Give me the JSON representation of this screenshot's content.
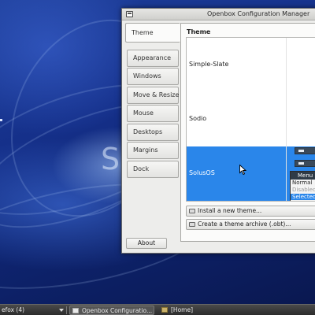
{
  "wallpaper": {
    "logo_text": "S"
  },
  "window": {
    "title": "Openbox Configuration Manager",
    "tabs": [
      {
        "label": "Theme",
        "active": true
      },
      {
        "label": "Appearance"
      },
      {
        "label": "Windows"
      },
      {
        "label": "Move & Resize"
      },
      {
        "label": "Mouse"
      },
      {
        "label": "Desktops"
      },
      {
        "label": "Margins"
      },
      {
        "label": "Dock"
      }
    ],
    "section_heading": "Theme",
    "themes": [
      {
        "name": "Simple-Slate"
      },
      {
        "name": "Sodio"
      },
      {
        "name": "SolusOS",
        "selected": true
      }
    ],
    "preview": {
      "menu_title": "Menu",
      "items": [
        "Normal",
        "Disabled",
        "Selected"
      ]
    },
    "install_button": "Install a new theme...",
    "archive_button": "Create a theme archive (.obt)...",
    "about_button": "About"
  },
  "taskbar": {
    "firefox": "efox (4)",
    "openbox": "Openbox Configuratio...",
    "home": "[Home]"
  },
  "colors": {
    "selection": "#2a86ea",
    "window_bg": "#ededeb",
    "taskbar": "#2c2c2c"
  }
}
